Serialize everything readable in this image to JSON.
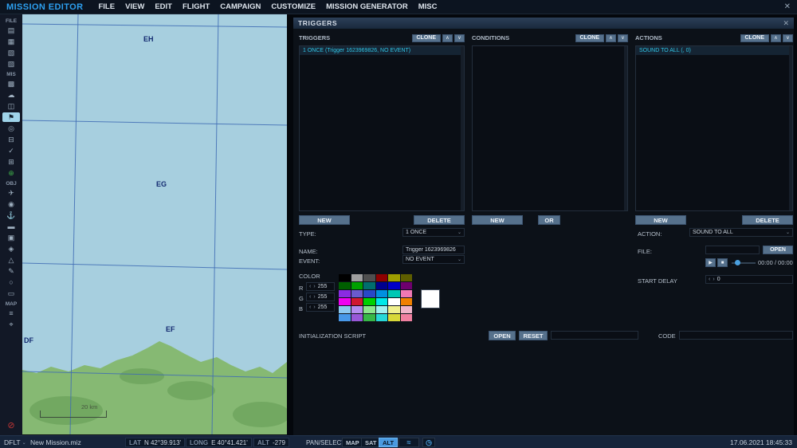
{
  "icons": {
    "close": "✕",
    "chevron_down": "⌄",
    "up": "∧",
    "down": "∨",
    "left": "‹",
    "right": "›",
    "play": "▶",
    "stop": "■",
    "mixer": "≈",
    "clock": "◷"
  },
  "menubar": {
    "title": "MISSION EDITOR",
    "items": [
      "FILE",
      "VIEW",
      "EDIT",
      "FLIGHT",
      "CAMPAIGN",
      "CUSTOMIZE",
      "MISSION GENERATOR",
      "MISC"
    ]
  },
  "sidebar": {
    "items": [
      {
        "type": "label",
        "text": "FILE"
      },
      {
        "type": "icon",
        "name": "new-mission-icon",
        "glyph": "▤"
      },
      {
        "type": "icon",
        "name": "open-mission-icon",
        "glyph": "▦"
      },
      {
        "type": "icon",
        "name": "save-mission-icon",
        "glyph": "▧"
      },
      {
        "type": "icon",
        "name": "save-as-icon",
        "glyph": "▨"
      },
      {
        "type": "label",
        "text": "MIS"
      },
      {
        "type": "icon",
        "name": "briefing-icon",
        "glyph": "▩"
      },
      {
        "type": "icon",
        "name": "weather-icon",
        "glyph": "☁"
      },
      {
        "type": "icon",
        "name": "rules-icon",
        "glyph": "◫"
      },
      {
        "type": "icon",
        "name": "triggers-icon",
        "glyph": "⚑",
        "selected": true
      },
      {
        "type": "icon",
        "name": "goals-icon",
        "glyph": "◎"
      },
      {
        "type": "icon",
        "name": "failures-icon",
        "glyph": "⊟"
      },
      {
        "type": "icon",
        "name": "summary-icon",
        "glyph": "✓"
      },
      {
        "type": "icon",
        "name": "generator-icon",
        "glyph": "⊞"
      },
      {
        "type": "icon",
        "name": "add-unit-icon",
        "glyph": "⊕",
        "color": "#3fae4a"
      },
      {
        "type": "label",
        "text": "OBJ"
      },
      {
        "type": "icon",
        "name": "airplane-icon",
        "glyph": "✈"
      },
      {
        "type": "icon",
        "name": "helicopter-icon",
        "glyph": "◉"
      },
      {
        "type": "icon",
        "name": "ship-icon",
        "glyph": "⚓"
      },
      {
        "type": "icon",
        "name": "vehicle-icon",
        "glyph": "▬"
      },
      {
        "type": "icon",
        "name": "static-object-icon",
        "glyph": "▣"
      },
      {
        "type": "icon",
        "name": "template-icon",
        "glyph": "◈"
      },
      {
        "type": "icon",
        "name": "zone-icon",
        "glyph": "△"
      },
      {
        "type": "icon",
        "name": "drawing-icon",
        "glyph": "✎"
      },
      {
        "type": "icon",
        "name": "distance-tool-icon",
        "glyph": "○"
      },
      {
        "type": "icon",
        "name": "ruler-icon",
        "glyph": "▭"
      },
      {
        "type": "label",
        "text": "MAP"
      },
      {
        "type": "icon",
        "name": "layers-icon",
        "glyph": "≡"
      },
      {
        "type": "icon",
        "name": "marker-icon",
        "glyph": "⌖"
      },
      {
        "type": "icon",
        "name": "record-icon",
        "glyph": "⊘",
        "color": "#c23535",
        "bottom": true
      }
    ]
  },
  "map": {
    "grid_labels": {
      "eh": "EH",
      "eg": "EG",
      "ef": "EF",
      "df": "DF"
    },
    "scale_text": "20 km",
    "colors": {
      "water": "#a7cfdf",
      "land": "#86b973",
      "land_dark": "#6fa45e",
      "grid": "#3f6cb4"
    }
  },
  "panel": {
    "title": "TRIGGERS",
    "triggers": {
      "header": "TRIGGERS",
      "clone_label": "CLONE",
      "items": [
        "1 ONCE (Trigger 1623969826, NO EVENT)"
      ],
      "new_label": "NEW",
      "delete_label": "DELETE"
    },
    "conditions": {
      "header": "CONDITIONS",
      "clone_label": "CLONE",
      "new_label": "NEW",
      "or_label": "OR"
    },
    "actions": {
      "header": "ACTIONS",
      "clone_label": "CLONE",
      "items": [
        "SOUND TO ALL (, 0)"
      ],
      "new_label": "NEW",
      "delete_label": "DELETE"
    },
    "form": {
      "type_label": "TYPE:",
      "type_value": "1 ONCE",
      "name_label": "NAME:",
      "name_value": "Trigger 1623969826",
      "event_label": "EVENT:",
      "event_value": "NO EVENT",
      "color_label": "COLOR",
      "rgb": [
        {
          "label": "R",
          "value": "255"
        },
        {
          "label": "G",
          "value": "255"
        },
        {
          "label": "B",
          "value": "255"
        }
      ],
      "palette": [
        "#000000",
        "#9e9e9e",
        "#4f4f4f",
        "#8e0000",
        "#9e9e00",
        "#5e5e00",
        "#005e00",
        "#00a000",
        "#006e6e",
        "#00008e",
        "#0000c8",
        "#6e006e",
        "#8a2be2",
        "#6a5acd",
        "#2848c8",
        "#0090e0",
        "#00c8b4",
        "#f078b4",
        "#f000f0",
        "#d01830",
        "#00d000",
        "#00e8e8",
        "#ffffff",
        "#f08000",
        "#8cc8f0",
        "#b48cf0",
        "#8ce88c",
        "#a0f0f0",
        "#f0f08c",
        "#f0b4c8",
        "#4898e8",
        "#9858d8",
        "#38b848",
        "#28d8d8",
        "#d8d838",
        "#f080a0"
      ],
      "selected_color": "#ffffff",
      "action_label": "ACTION:",
      "action_value": "SOUND TO ALL",
      "file_label": "FILE:",
      "open_label": "OPEN",
      "time_text": "00:00 / 00:00",
      "start_delay_label": "START DELAY",
      "start_delay_value": "0"
    },
    "init_script": {
      "label": "INITIALIZATION SCRIPT",
      "open_label": "OPEN",
      "reset_label": "RESET",
      "code_label": "CODE"
    }
  },
  "statusbar": {
    "profile": "DFLT",
    "mission_name": "New Mission.miz",
    "lat_label": "LAT",
    "lat_value": "N 42°39.913'",
    "long_label": "LONG",
    "long_value": "E 40°41.421'",
    "alt_label": "ALT",
    "alt_value": "-279",
    "mode_label": "PAN/SELECT",
    "map_label": "MAP",
    "sat_label": "SAT",
    "alt_button_label": "ALT",
    "datetime": "17.06.2021 18:45:33"
  }
}
